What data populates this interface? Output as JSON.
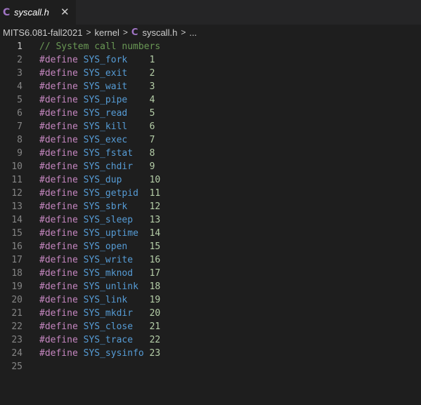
{
  "tab": {
    "icon": "C",
    "filename": "syscall.h",
    "close": "✕"
  },
  "breadcrumb": {
    "items": [
      "MITS6.081-fall2021",
      "kernel",
      "syscall.h",
      "..."
    ],
    "separator": ">",
    "file_icon": "C"
  },
  "editor": {
    "active_line": 1,
    "comment": "// System call numbers",
    "keyword": "#define",
    "defines": [
      {
        "name": "SYS_fork",
        "value": "1"
      },
      {
        "name": "SYS_exit",
        "value": "2"
      },
      {
        "name": "SYS_wait",
        "value": "3"
      },
      {
        "name": "SYS_pipe",
        "value": "4"
      },
      {
        "name": "SYS_read",
        "value": "5"
      },
      {
        "name": "SYS_kill",
        "value": "6"
      },
      {
        "name": "SYS_exec",
        "value": "7"
      },
      {
        "name": "SYS_fstat",
        "value": "8"
      },
      {
        "name": "SYS_chdir",
        "value": "9"
      },
      {
        "name": "SYS_dup",
        "value": "10"
      },
      {
        "name": "SYS_getpid",
        "value": "11"
      },
      {
        "name": "SYS_sbrk",
        "value": "12"
      },
      {
        "name": "SYS_sleep",
        "value": "13"
      },
      {
        "name": "SYS_uptime",
        "value": "14"
      },
      {
        "name": "SYS_open",
        "value": "15"
      },
      {
        "name": "SYS_write",
        "value": "16"
      },
      {
        "name": "SYS_mknod",
        "value": "17"
      },
      {
        "name": "SYS_unlink",
        "value": "18"
      },
      {
        "name": "SYS_link",
        "value": "19"
      },
      {
        "name": "SYS_mkdir",
        "value": "20"
      },
      {
        "name": "SYS_close",
        "value": "21"
      },
      {
        "name": "SYS_trace",
        "value": "22"
      },
      {
        "name": "SYS_sysinfo",
        "value": "23"
      }
    ],
    "last_line_number": "25"
  },
  "colors": {
    "background": "#1e1e1e",
    "tabbar": "#252526",
    "keyword": "#c586c0",
    "macro_name": "#569cd6",
    "number": "#b5cea8",
    "comment": "#6a9955",
    "c_icon": "#a074c4"
  }
}
